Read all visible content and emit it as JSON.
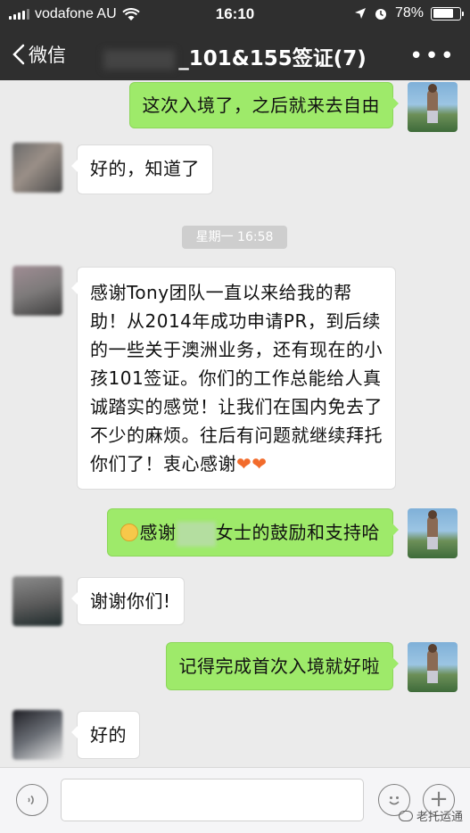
{
  "status_bar": {
    "carrier": "vodafone AU",
    "time": "16:10",
    "battery": "78%",
    "battery_level": 0.78
  },
  "nav": {
    "back_label": "微信",
    "title": "_101&155签证(7)",
    "more_icon": "more-icon"
  },
  "chat": {
    "messages": [
      {
        "side": "self",
        "text": "这次入境了，之后就来去自由"
      },
      {
        "side": "other",
        "text": "好的，知道了"
      },
      {
        "side": "separator",
        "text": "星期一 16:58"
      },
      {
        "side": "other",
        "text": "感谢Tony团队一直以来给我的帮助！从2014年成功申请PR，到后续的一些关于澳洲业务，还有现在的小孩101签证。你们的工作总能给人真诚踏实的感觉！让我们在国内免去了不少的麻烦。往后有问题就继续拜托你们了！衷心感谢"
      },
      {
        "side": "self",
        "prefix": "感谢",
        "suffix": "女士的鼓励和支持哈"
      },
      {
        "side": "other",
        "text": "谢谢你们!"
      },
      {
        "side": "self",
        "text": "记得完成首次入境就好啦"
      },
      {
        "side": "other",
        "text": "好的"
      }
    ]
  },
  "input_bar": {
    "voice_icon": "voice-icon",
    "emoji_icon": "emoji-icon",
    "plus_icon": "plus-icon",
    "watermark": "老托运通"
  },
  "colors": {
    "header_bg": "#2f2f2f",
    "chat_bg": "#ebebeb",
    "self_bubble": "#9eea6a",
    "other_bubble": "#ffffff"
  }
}
